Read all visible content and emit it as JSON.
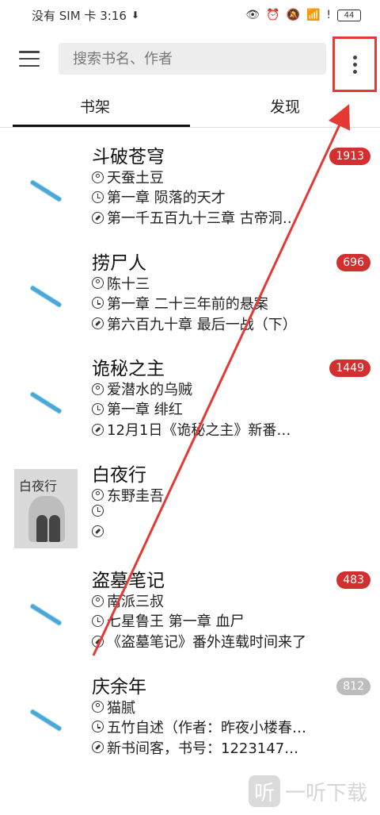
{
  "status_bar": {
    "carrier_time": "没有 SIM 卡 3:16",
    "battery": "44"
  },
  "header": {
    "search_placeholder": "搜索书名、作者"
  },
  "tabs": [
    {
      "label": "书架",
      "active": true
    },
    {
      "label": "发现",
      "active": false
    }
  ],
  "books": [
    {
      "title": "斗破苍穹",
      "author": "天蚕土豆",
      "latest": "第一章 陨落的天才",
      "recent": "第一千五百九十三章 古帝洞…",
      "badge": "1913",
      "badge_style": "red",
      "cover": "placeholder"
    },
    {
      "title": "捞尸人",
      "author": "陈十三",
      "latest": "第一章 二十三年前的悬案",
      "recent": "第六百九十章 最后一战（下）",
      "badge": "696",
      "badge_style": "red",
      "cover": "placeholder"
    },
    {
      "title": "诡秘之主",
      "author": "爱潜水的乌贼",
      "latest": "第一章 绯红",
      "recent": "12月1日《诡秘之主》新番…",
      "badge": "1449",
      "badge_style": "red",
      "cover": "placeholder"
    },
    {
      "title": "白夜行",
      "author": "东野圭吾",
      "latest": "",
      "recent": "",
      "badge": "",
      "badge_style": "none",
      "cover": "image",
      "cover_title": "白夜行"
    },
    {
      "title": "盗墓笔记",
      "author": "南派三叔",
      "latest": "七星鲁王 第一章 血尸",
      "recent": "《盗墓笔记》番外连载时间来了",
      "badge": "483",
      "badge_style": "red",
      "cover": "placeholder"
    },
    {
      "title": "庆余年",
      "author": "猫腻",
      "latest": "五竹自述（作者：昨夜小楼春…",
      "recent": "新书间客，书号：1223147…",
      "badge": "812",
      "badge_style": "gray",
      "cover": "placeholder"
    }
  ],
  "watermark": {
    "logo": "听",
    "text": "一听下载"
  },
  "colors": {
    "accent_red": "#d32f2f",
    "annotation_red": "#e53935",
    "badge_gray": "#bdbdbd"
  }
}
